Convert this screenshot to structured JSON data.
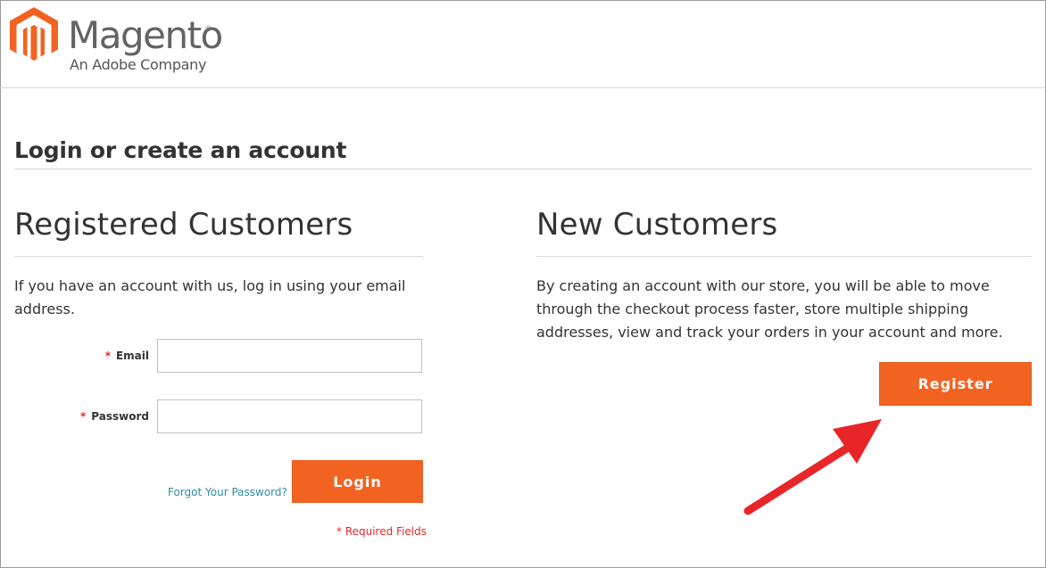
{
  "brand": {
    "name": "Magento",
    "registered_mark": "®",
    "tagline": "An Adobe Company",
    "logo_icon": "magento-logo-icon",
    "accent_color": "#f26322"
  },
  "page": {
    "title": "Login or create an account"
  },
  "registered": {
    "title": "Registered Customers",
    "intro": "If you have an account with us, log in using your email address.",
    "email_label": "Email",
    "email_value": "",
    "password_label": "Password",
    "password_value": "",
    "required_marker": "*",
    "forgot_link": "Forgot Your Password?",
    "login_label": "Login",
    "required_note": "* Required Fields"
  },
  "new_customers": {
    "title": "New Customers",
    "intro": "By creating an account with our store, you will be able to move through the checkout process faster, store multiple shipping addresses, view and track your orders in your account and more.",
    "register_label": "Register"
  },
  "annotation": {
    "arrow_color": "#e8262a",
    "icon": "red-arrow-icon"
  }
}
